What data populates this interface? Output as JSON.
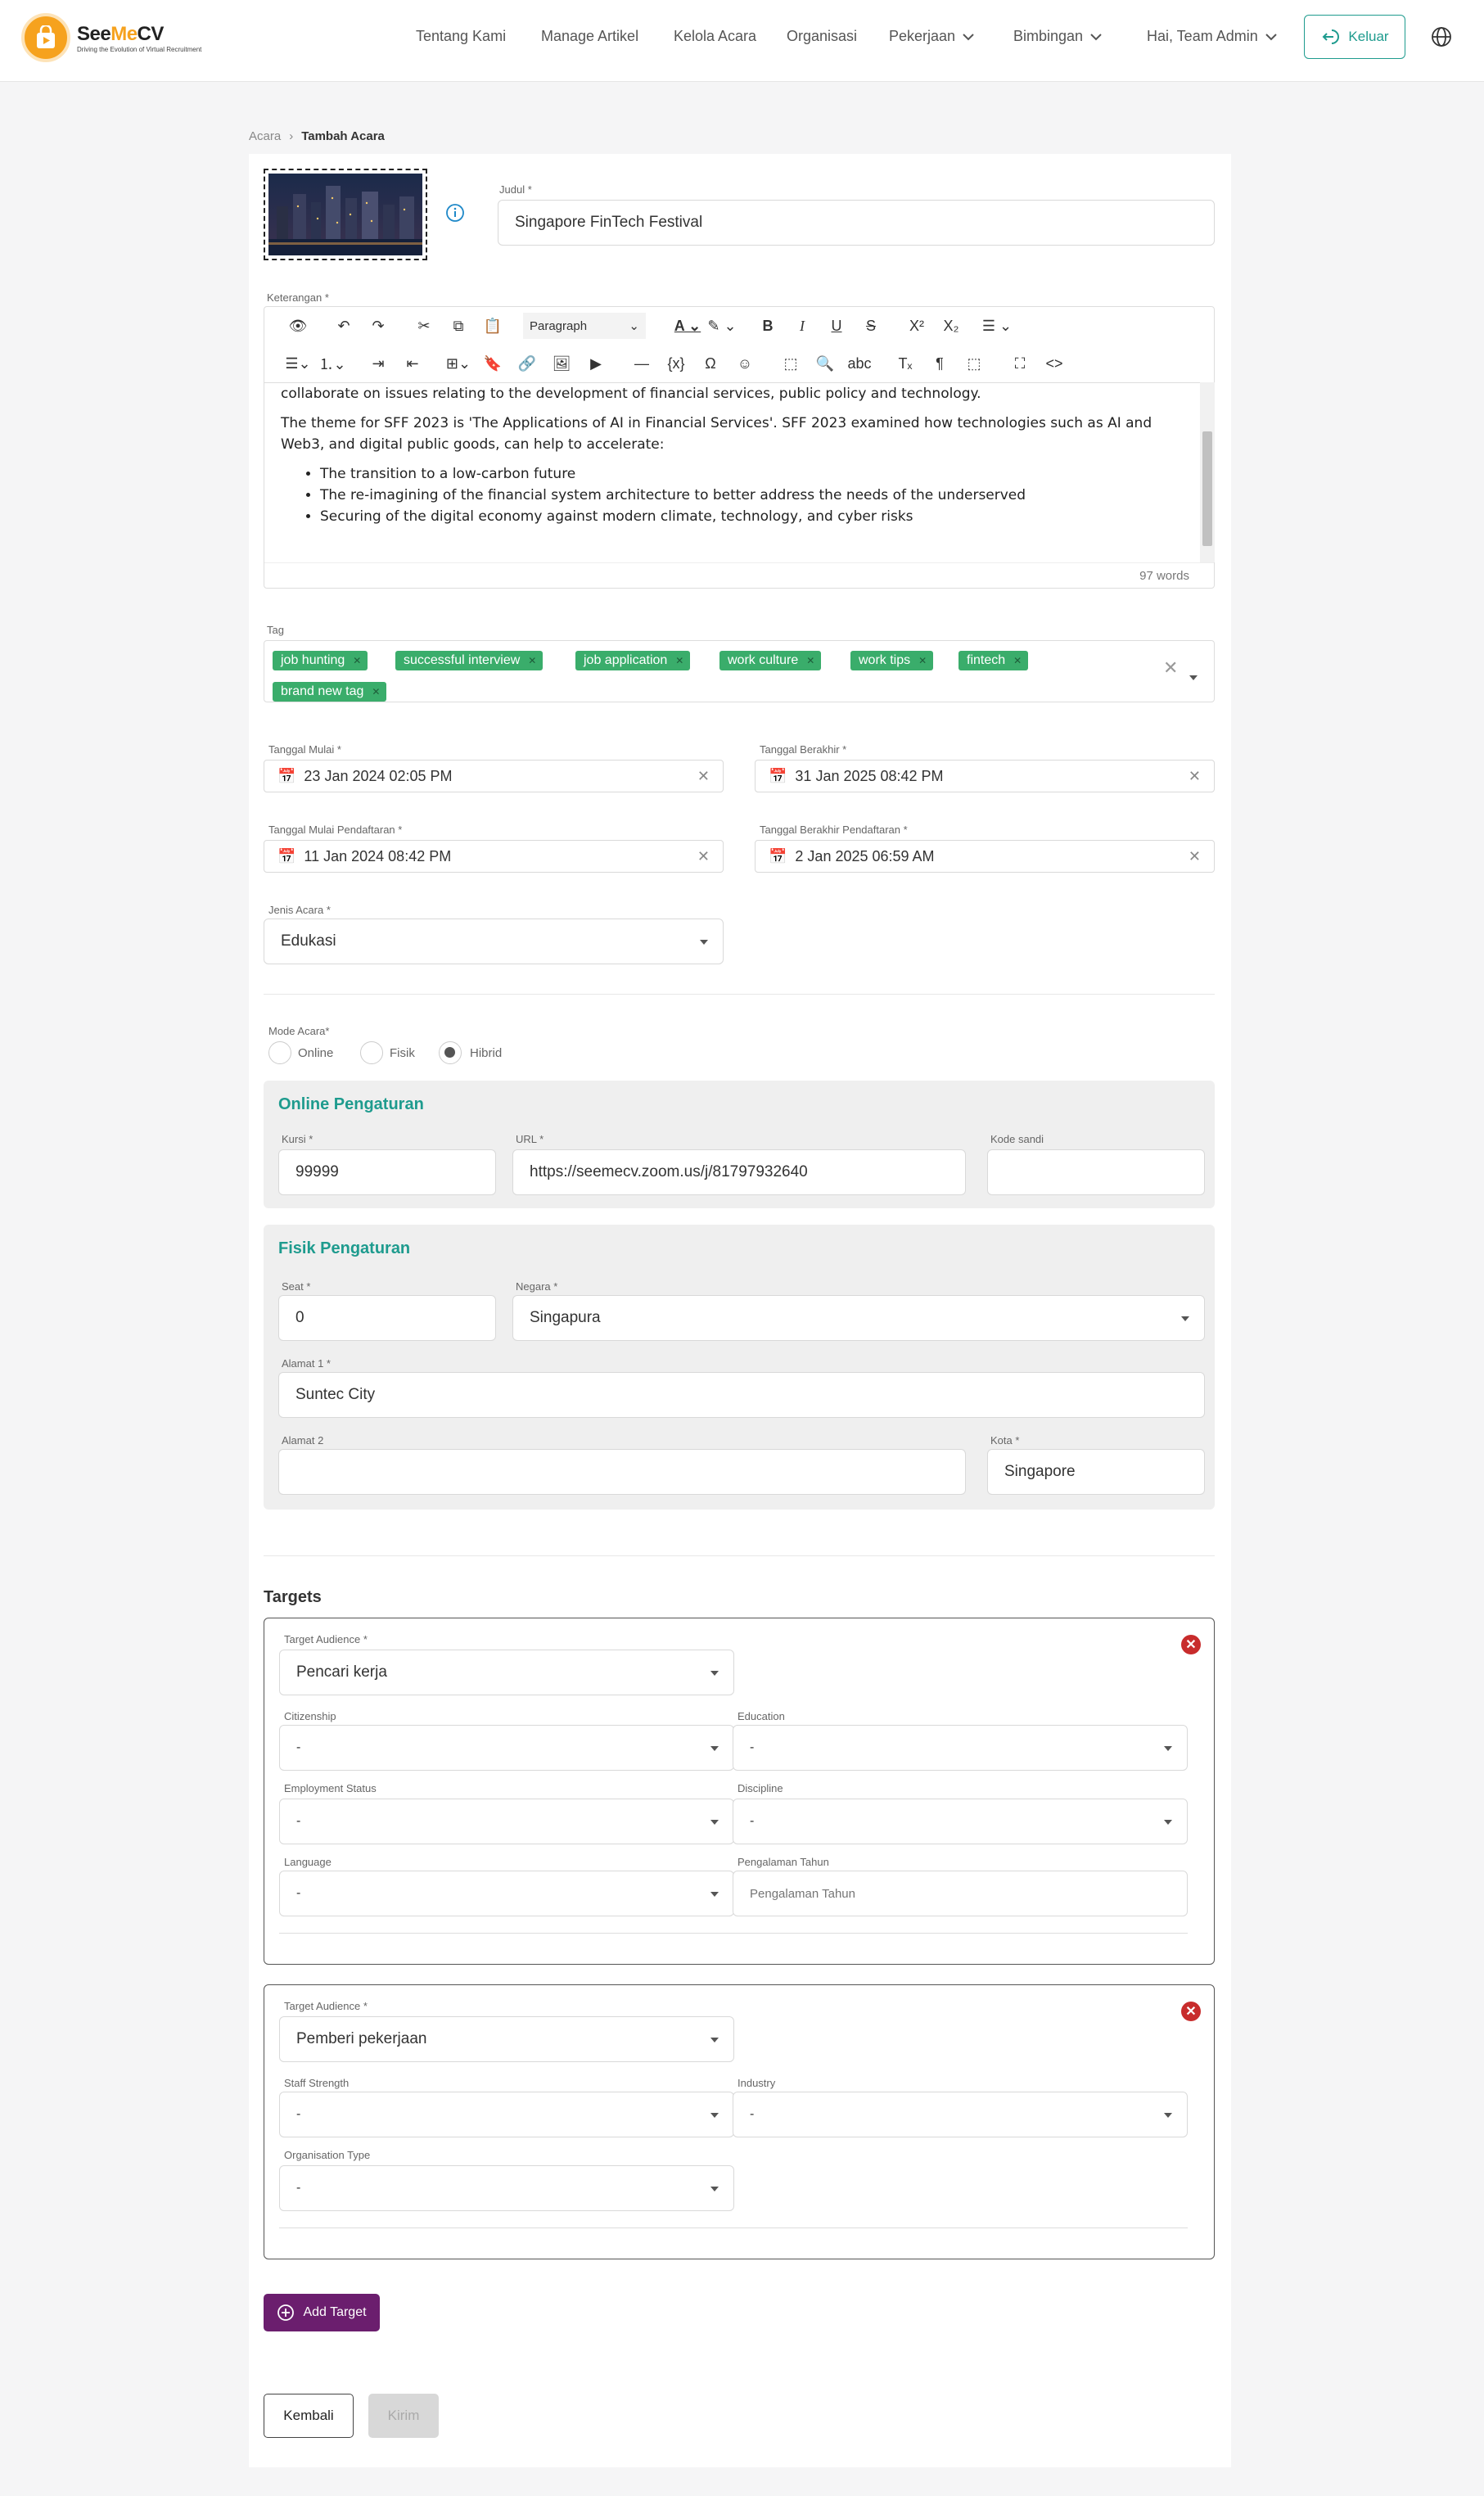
{
  "nav": {
    "brand_see": "See",
    "brand_me": "Me",
    "brand_cv": "CV",
    "brand_tagline": "Driving the Evolution of Virtual Recruitment",
    "items": [
      "Tentang Kami",
      "Manage Artikel",
      "Kelola Acara",
      "Organisasi",
      "Pekerjaan",
      "Bimbingan",
      "Hai, Team Admin"
    ],
    "logout": "Keluar"
  },
  "breadcrumb": {
    "parent": "Acara",
    "current": "Tambah Acara"
  },
  "form": {
    "title_label": "Judul *",
    "title_value": "Singapore FinTech Festival",
    "desc_label": "Keterangan *",
    "editor": {
      "paragraph_select": "Paragraph",
      "p1": "collaborate on issues relating to the development of financial services, public policy and technology.",
      "p2": "The theme for SFF 2023 is 'The Applications of AI in Financial Services'. SFF 2023 examined how technologies such as AI and Web3, and digital public goods, can help to accelerate:",
      "bullets": [
        "The transition to a low-carbon future",
        "The re-imagining of the financial system architecture to better address the needs of the underserved",
        "Securing of the digital economy against modern climate, technology, and cyber risks"
      ],
      "word_count": "97 words"
    },
    "tag_label": "Tag",
    "tags": [
      "job hunting",
      "successful interview",
      "job application",
      "work culture",
      "work tips",
      "fintech",
      "brand new tag"
    ],
    "start_label": "Tanggal Mulai *",
    "start_value": "23 Jan 2024 02:05 PM",
    "end_label": "Tanggal Berakhir *",
    "end_value": "31 Jan 2025 08:42 PM",
    "reg_start_label": "Tanggal Mulai Pendaftaran *",
    "reg_start_value": "11 Jan 2024 08:42 PM",
    "reg_end_label": "Tanggal Berakhir Pendaftaran *",
    "reg_end_value": "2 Jan 2025 06:59 AM",
    "type_label": "Jenis Acara *",
    "type_value": "Edukasi",
    "mode_label": "Mode Acara*",
    "modes": [
      "Online",
      "Fisik",
      "Hibrid"
    ],
    "mode_selected": "Hibrid"
  },
  "online": {
    "title": "Online Pengaturan",
    "seats_label": "Kursi *",
    "seats_value": "99999",
    "url_label": "URL *",
    "url_value": "https://seemecv.zoom.us/j/81797932640",
    "password_label": "Kode sandi",
    "password_value": ""
  },
  "physical": {
    "title": "Fisik Pengaturan",
    "seat_label": "Seat *",
    "seat_value": "0",
    "country_label": "Negara *",
    "country_value": "Singapura",
    "addr1_label": "Alamat 1 *",
    "addr1_value": "Suntec City",
    "addr2_label": "Alamat 2",
    "addr2_value": "",
    "city_label": "Kota *",
    "city_value": "Singapore"
  },
  "targets": {
    "heading": "Targets",
    "t1": {
      "audience_label": "Target Audience *",
      "audience_value": "Pencari kerja",
      "citizenship_label": "Citizenship",
      "citizenship_value": "-",
      "education_label": "Education",
      "education_value": "-",
      "employment_label": "Employment Status",
      "employment_value": "-",
      "discipline_label": "Discipline",
      "discipline_value": "-",
      "language_label": "Language",
      "language_value": "-",
      "experience_label": "Pengalaman Tahun",
      "experience_placeholder": "Pengalaman Tahun"
    },
    "t2": {
      "audience_label": "Target Audience *",
      "audience_value": "Pemberi pekerjaan",
      "staff_label": "Staff Strength",
      "staff_value": "-",
      "industry_label": "Industry",
      "industry_value": "-",
      "orgtype_label": "Organisation Type",
      "orgtype_value": "-"
    },
    "add": "Add Target"
  },
  "actions": {
    "back": "Kembali",
    "submit": "Kirim"
  }
}
